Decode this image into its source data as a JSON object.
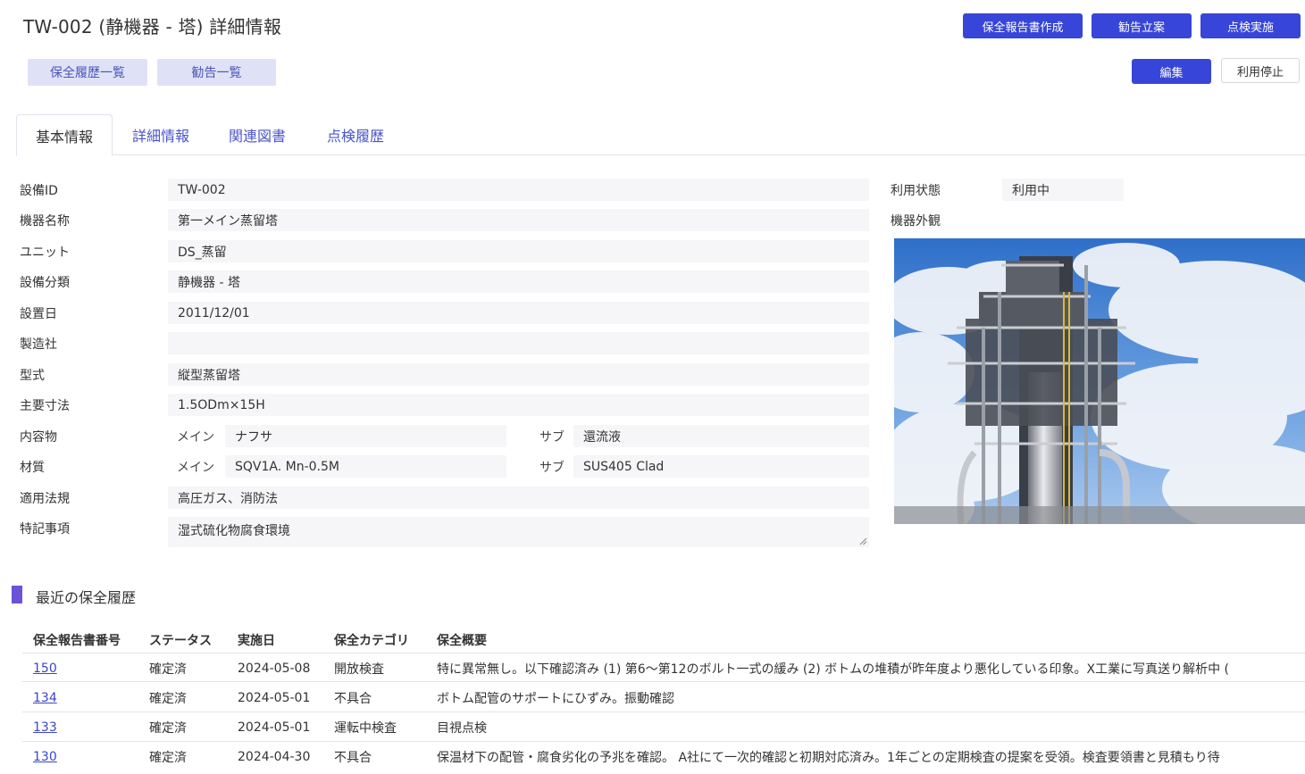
{
  "page_title": "TW-002 (静機器 - 塔) 詳細情報",
  "actions": {
    "create_report": "保全報告書作成",
    "recommendation": "勧告立案",
    "inspection": "点検実施",
    "edit": "編集",
    "suspend": "利用停止",
    "history_list": "保全履歴一覧",
    "recommend_list": "勧告一覧"
  },
  "tabs": [
    "基本情報",
    "詳細情報",
    "関連図書",
    "点検履歴"
  ],
  "fields": {
    "equipment_id": {
      "label": "設備ID",
      "value": "TW-002"
    },
    "name": {
      "label": "機器名称",
      "value": "第一メイン蒸留塔"
    },
    "unit": {
      "label": "ユニット",
      "value": "DS_蒸留"
    },
    "category": {
      "label": "設備分類",
      "value": "静機器 - 塔"
    },
    "installed": {
      "label": "設置日",
      "value": "2011/12/01"
    },
    "maker": {
      "label": "製造社",
      "value": ""
    },
    "model": {
      "label": "型式",
      "value": "縦型蒸留塔"
    },
    "dimensions": {
      "label": "主要寸法",
      "value": "1.5ODm×15H"
    },
    "contents": {
      "label": "内容物",
      "main_label": "メイン",
      "main": "ナフサ",
      "sub_label": "サブ",
      "sub": "還流液"
    },
    "material": {
      "label": "材質",
      "main_label": "メイン",
      "main": "SQV1A. Mn-0.5M",
      "sub_label": "サブ",
      "sub": "SUS405 Clad"
    },
    "regulation": {
      "label": "適用法規",
      "value": "高圧ガス、消防法"
    },
    "notes": {
      "label": "特記事項",
      "value": "湿式硫化物腐食環境"
    },
    "status": {
      "label": "利用状態",
      "value": "利用中"
    },
    "appearance": {
      "label": "機器外観"
    }
  },
  "history": {
    "title": "最近の保全履歴",
    "headers": [
      "保全報告書番号",
      "ステータス",
      "実施日",
      "保全カテゴリ",
      "保全概要"
    ],
    "rows": [
      {
        "no": "150",
        "status": "確定済",
        "date": "2024-05-08",
        "category": "開放検査",
        "summary": "特に異常無し。以下確認済み (1) 第6～第12のボルト一式の緩み (2) ボトムの堆積が昨年度より悪化している印象。X工業に写真送り解析中 ("
      },
      {
        "no": "134",
        "status": "確定済",
        "date": "2024-05-01",
        "category": "不具合",
        "summary": "ボトム配管のサポートにひずみ。振動確認"
      },
      {
        "no": "133",
        "status": "確定済",
        "date": "2024-05-01",
        "category": "運転中検査",
        "summary": "目視点検"
      },
      {
        "no": "130",
        "status": "確定済",
        "date": "2024-04-30",
        "category": "不具合",
        "summary": "保温材下の配管・腐食劣化の予兆を確認。 A社にて一次的確認と初期対応済み。1年ごとの定期検査の提案を受領。検査要領書と見積もり待"
      }
    ]
  },
  "colors": {
    "primary": "#3745d8",
    "light_button": "#dfe1f6",
    "accent": "#6b52d6",
    "link": "#3a44c8"
  }
}
